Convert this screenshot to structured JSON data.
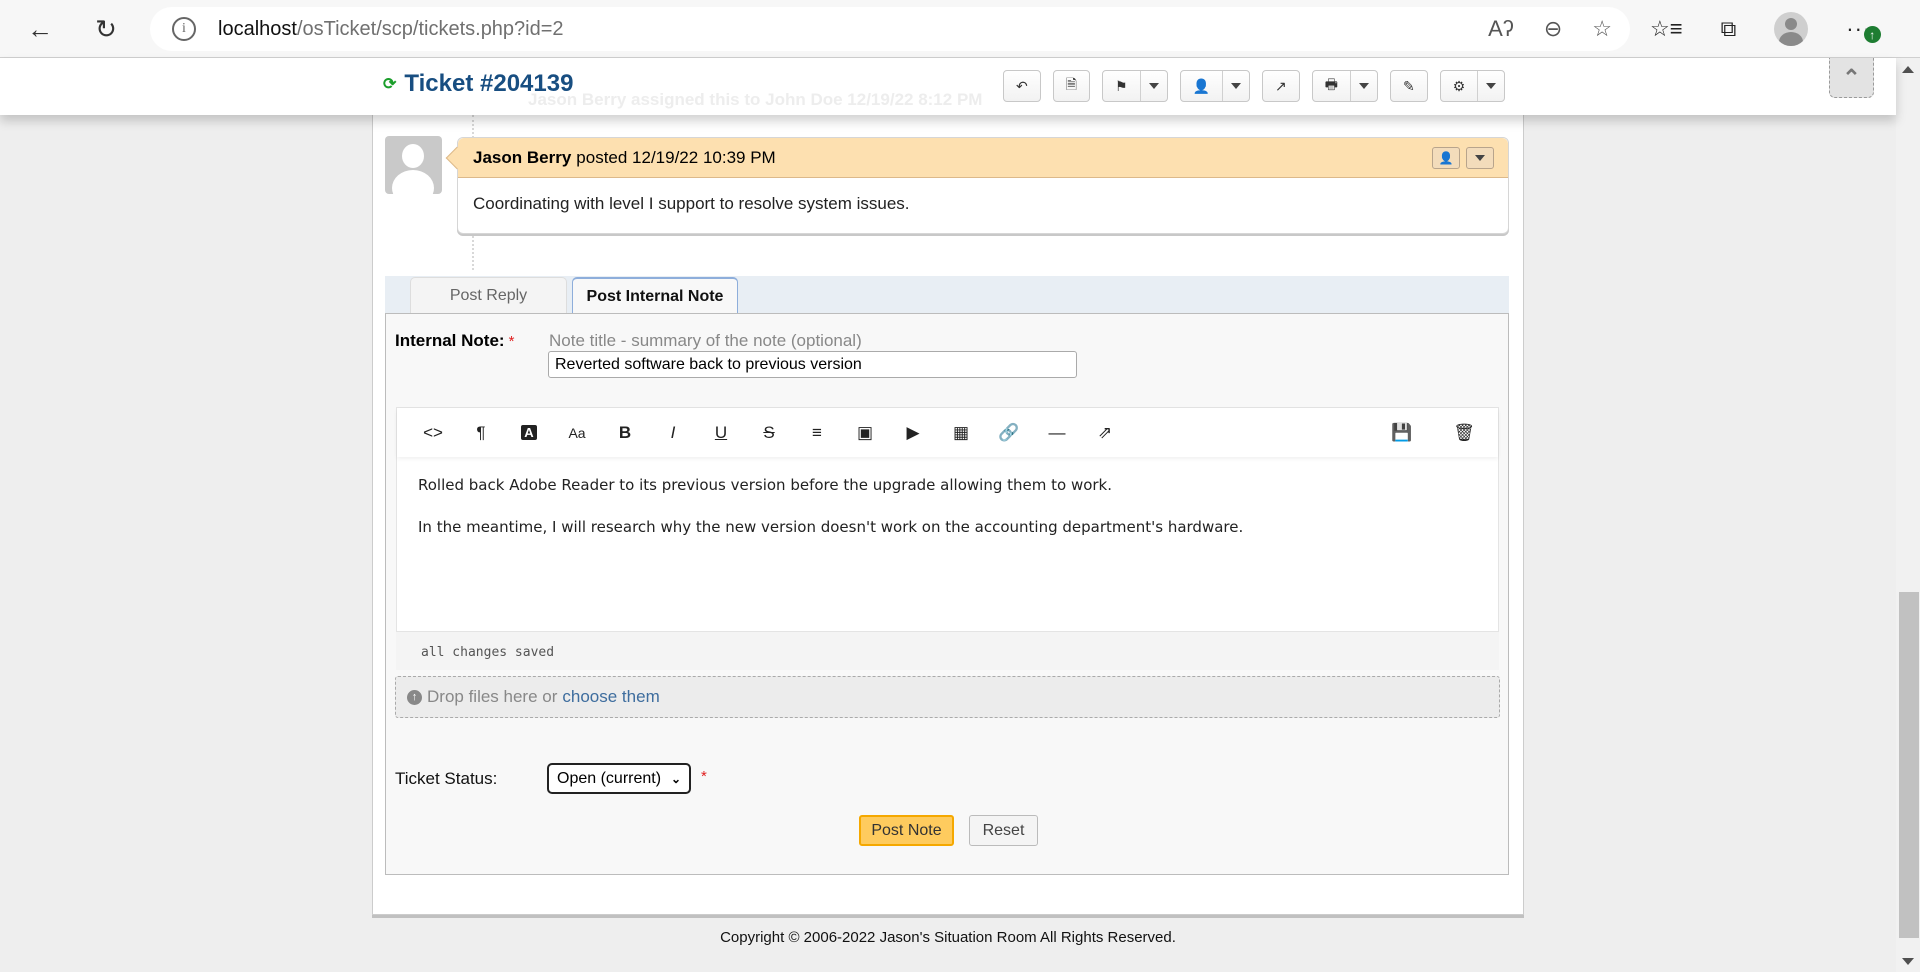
{
  "browser": {
    "url_host": "localhost",
    "url_path": "/osTicket/scp/tickets.php?id=2",
    "icons": [
      "back-icon",
      "refresh-icon",
      "site-info-icon",
      "read-aloud-icon",
      "zoom-out-icon",
      "add-favorite-icon",
      "favorites-icon",
      "collections-icon",
      "profile-icon",
      "more-icon"
    ]
  },
  "header": {
    "ticket_title": "Ticket #204139",
    "ghost_event": "Jason Berry assigned this to John Doe 12/19/22 8:12 PM",
    "toolbar": [
      {
        "name": "reply",
        "icon": "reply-icon",
        "dropdown": false
      },
      {
        "name": "print-pdf",
        "icon": "file-icon",
        "dropdown": false
      },
      {
        "name": "flag",
        "icon": "flag-icon",
        "dropdown": true
      },
      {
        "name": "assign",
        "icon": "user-icon",
        "dropdown": true
      },
      {
        "name": "transfer",
        "icon": "share-icon",
        "dropdown": false
      },
      {
        "name": "print",
        "icon": "print-icon",
        "dropdown": true
      },
      {
        "name": "edit",
        "icon": "edit-icon",
        "dropdown": false
      },
      {
        "name": "more",
        "icon": "gear-icon",
        "dropdown": true
      }
    ]
  },
  "thread": {
    "entry": {
      "author": "Jason Berry",
      "action": "posted 12/19/22 10:39 PM",
      "body": "Coordinating with level I support to resolve system issues."
    }
  },
  "tabs": [
    {
      "label": "Post Reply",
      "active": false
    },
    {
      "label": "Post Internal Note",
      "active": true
    }
  ],
  "form": {
    "note_label": "Internal Note:",
    "required_mark": "*",
    "title_hint": "Note title - summary of the note (optional)",
    "title_value": "Reverted software back to previous version",
    "editor_tools": [
      "code",
      "paragraph",
      "text-color",
      "font-size",
      "bold",
      "italic",
      "underline",
      "strikethrough",
      "list",
      "image",
      "video",
      "table",
      "link",
      "horizontal-rule",
      "fullscreen"
    ],
    "editor_paragraphs": [
      "Rolled back Adobe Reader to its previous version before the upgrade allowing them to work.",
      "In the meantime, I will research why the new version doesn't work on the accounting department's hardware."
    ],
    "save_status": "all changes saved",
    "drop_text": "Drop files here or",
    "drop_link": "choose them",
    "status_label": "Ticket Status:",
    "status_value": "Open (current)",
    "post_label": "Post Note",
    "reset_label": "Reset"
  },
  "footer": {
    "copyright": "Copyright © 2006-2022 Jason's Situation Room All Rights Reserved."
  }
}
